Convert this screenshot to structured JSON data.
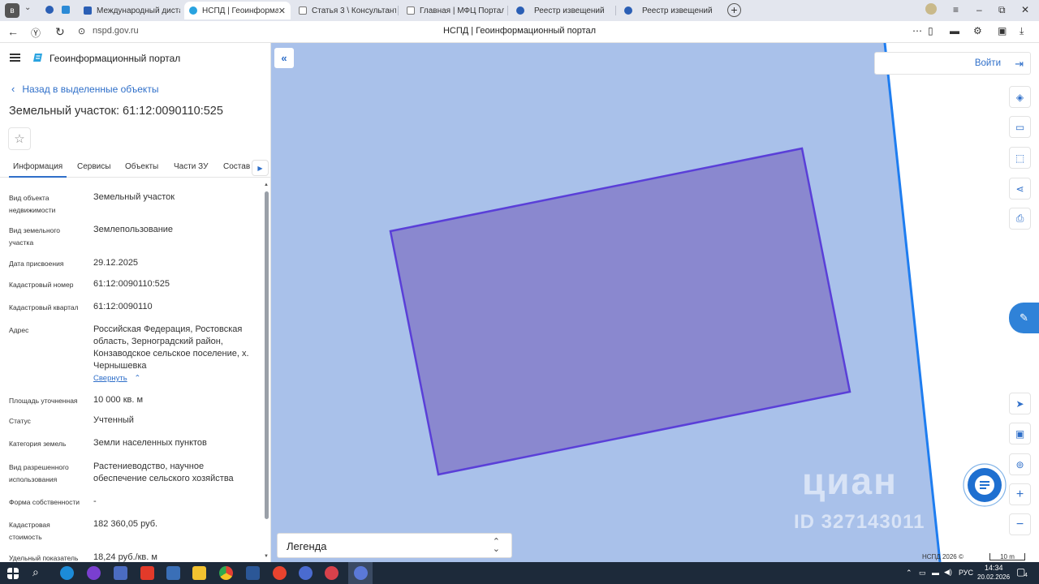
{
  "browser": {
    "tabs": [
      {
        "label": "Международный дистан",
        "color": "#2b5fb5",
        "active": false
      },
      {
        "label": "НСПД | Геоинформаци",
        "color": "#29a3e0",
        "active": true
      },
      {
        "label": "Статья 3 \\ КонсультантП",
        "color": "#7a7a7a",
        "active": false
      },
      {
        "label": "Главная | МФЦ Портал",
        "color": "#7a7a7a",
        "active": false
      },
      {
        "label": "Реестр извещений",
        "color": "#2b5fb5",
        "active": false
      },
      {
        "label": "Реестр извещений",
        "color": "#2b5fb5",
        "active": false
      }
    ],
    "tab_close": "✕",
    "new_tab": "+",
    "url": "nspd.gov.ru",
    "page_title": "НСПД | Геоинформационный портал"
  },
  "panel": {
    "portal_name": "Геоинформационный портал",
    "back_label": "Назад в выделенные объекты",
    "title": "Земельный участок: 61:12:0090110:525",
    "tabs": [
      "Информация",
      "Сервисы",
      "Объекты",
      "Части ЗУ",
      "Состав"
    ],
    "collapse_label": "Свернуть",
    "rows": [
      {
        "label": "Вид объекта недвижимости",
        "value": "Земельный участок"
      },
      {
        "label": "Вид земельного участка",
        "value": "Землепользование"
      },
      {
        "label": "Дата присвоения",
        "value": "29.12.2025"
      },
      {
        "label": "Кадастровый номер",
        "value": "61:12:0090110:525"
      },
      {
        "label": "Кадастровый квартал",
        "value": "61:12:0090110"
      },
      {
        "label": "Адрес",
        "value": "Российская Федерация, Ростовская область, Зерноградский район, Конзаводское сельское поселение, х. Чернышевка"
      },
      {
        "label": "Площадь уточненная",
        "value": "10 000 кв. м"
      },
      {
        "label": "Статус",
        "value": "Учтенный"
      },
      {
        "label": "Категория земель",
        "value": "Земли населенных пунктов"
      },
      {
        "label": "Вид разрешенного использования",
        "value": "Растениеводство, научное обеспечение сельского хозяйства"
      },
      {
        "label": "Форма собственности",
        "value": "-"
      },
      {
        "label": "Кадастровая стоимость",
        "value": "182 360,05 руб."
      },
      {
        "label": "Удельный показатель",
        "value": "18,24 руб./кв. м"
      }
    ]
  },
  "map": {
    "login_label": "Войти",
    "legend_label": "Легенда",
    "copyright": "НСПД 2026 ©",
    "scale_label": "10 m",
    "watermark_brand": "циан",
    "watermark_id": "ID 327143011",
    "parcel_fill": "#8a88cf",
    "parcel_stroke": "#5a3fd8",
    "background": "#a9c1ea",
    "boundary_line": "#1e7df0"
  },
  "taskbar": {
    "language": "РУС",
    "time": "14:34",
    "date": "20.02.2026",
    "notification_count": "4"
  }
}
